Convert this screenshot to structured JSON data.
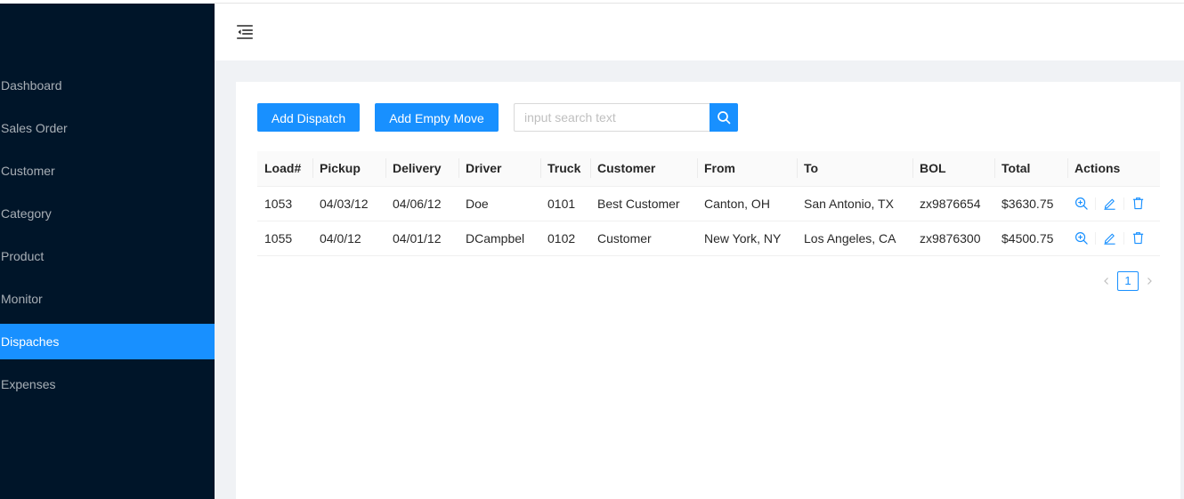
{
  "sidebar": {
    "items": [
      {
        "label": "Dashboard"
      },
      {
        "label": "Sales Order"
      },
      {
        "label": "Customer"
      },
      {
        "label": "Category"
      },
      {
        "label": "Product"
      },
      {
        "label": "Monitor"
      },
      {
        "label": "Dispaches"
      },
      {
        "label": "Expenses"
      }
    ],
    "active": "Dispaches"
  },
  "header": {
    "trigger_icon": "menu-fold-icon"
  },
  "toolbar": {
    "add_dispatch_label": "Add Dispatch",
    "add_empty_move_label": "Add Empty Move",
    "search_placeholder": "input search text",
    "search_value": ""
  },
  "table": {
    "columns": [
      "Load#",
      "Pickup",
      "Delivery",
      "Driver",
      "Truck",
      "Customer",
      "From",
      "To",
      "BOL",
      "Total",
      "Actions"
    ],
    "rows": [
      [
        "1053",
        "04/03/12",
        "04/06/12",
        "Doe",
        "0101",
        "Best Customer",
        "Canton, OH",
        "San Antonio, TX",
        "zx9876654",
        "$3630.75"
      ],
      [
        "1055",
        "04/0/12",
        "04/01/12",
        "DCampbel",
        "0102",
        "Customer",
        "New York, NY",
        "Los Angeles, CA",
        "zx9876300",
        "$4500.75"
      ]
    ],
    "action_icons": [
      "zoom-in-icon",
      "edit-icon",
      "delete-icon"
    ]
  },
  "pagination": {
    "current": "1"
  },
  "colors": {
    "sidebar_bg": "#001529",
    "accent": "#1890ff",
    "content_bg": "#f0f2f5"
  }
}
